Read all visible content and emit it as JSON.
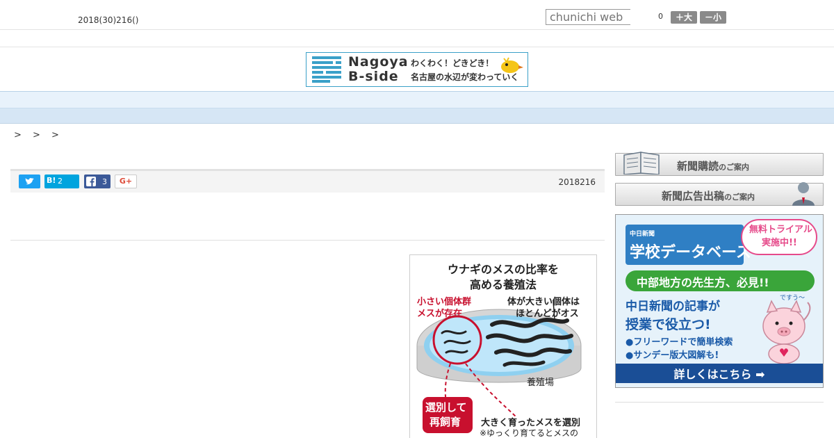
{
  "header": {
    "date": "2018(30)216()",
    "search_placeholder": "chunichi web",
    "font_count": "0",
    "font_larger": "＋大",
    "font_smaller": "－小"
  },
  "logo": {
    "line1": "Nagoya",
    "line2": "B-side",
    "tagline1": "わくわく！どきどき！",
    "tagline2": "名古屋の水辺が変わっていく"
  },
  "nav": {
    "items": [
      "",
      "",
      "",
      "",
      "",
      "",
      "",
      "",
      ""
    ]
  },
  "breadcrumb": "> > >",
  "share": {
    "hatena_label": "B!",
    "hatena_count": "2",
    "facebook_count": "3",
    "gplus_label": "G+",
    "date": "2018216"
  },
  "figure": {
    "title_line1": "ウナギのメスの比率を",
    "title_line2": "高める養殖法",
    "label_small_1": "小さい個体群",
    "label_small_2": "メスが存在",
    "label_large_1": "体が大きい個体は",
    "label_large_2": "ほとんどがオス",
    "label_farm": "養殖場",
    "label_reselect_1": "選別して",
    "label_reselect_2": "再飼育",
    "label_select": "大きく育ったメスを選別",
    "label_note": "※ゆっくり育てるとメスの"
  },
  "sidebar": {
    "subscribe_main": "新聞購読",
    "subscribe_sub": "のご案内",
    "ads_main": "新聞広告出稿",
    "ads_sub": "のご案内",
    "ad": {
      "small_title": "中日新聞",
      "main_title": "学校データベース",
      "bubble1": "無料トライアル",
      "bubble2": "実施中!!",
      "green": "中部地方の先生方、必見!!",
      "body1": "中日新聞の記事が",
      "body2": "授業で役立つ!",
      "bullet1": "●フリーワードで簡単検索",
      "bullet2": "●サンデー版大図解も!",
      "speech": "ですう〜",
      "cta": "詳しくはこちら ➡"
    }
  },
  "colors": {
    "twitter": "#1da1f2",
    "hatena": "#00a4de",
    "facebook": "#3b5998",
    "nav_bg": "#e8f2fb",
    "accent_red": "#c8102e"
  }
}
